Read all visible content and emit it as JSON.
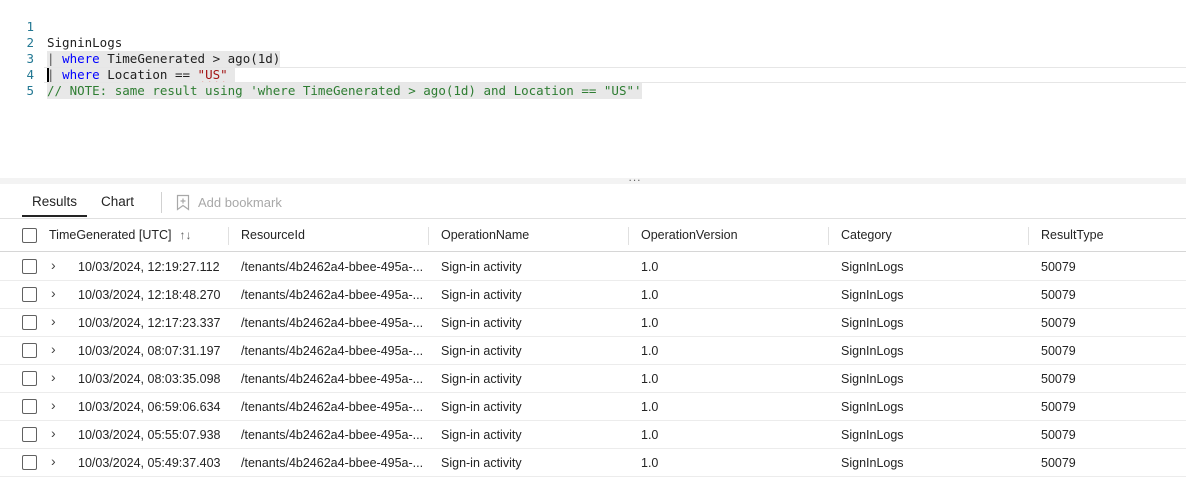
{
  "editor": {
    "line_numbers": [
      "1",
      "2",
      "3",
      "4",
      "5"
    ],
    "line1": "SigninLogs",
    "line2": {
      "pipe": "| ",
      "keyword": "where",
      "rest": " TimeGenerated > ago(1d)"
    },
    "line3": {
      "pipe": "| ",
      "keyword": "where",
      "rest": " Location == ",
      "string": "\"US\""
    },
    "line4_comment": "// NOTE: same result using 'where TimeGenerated > ago(1d) and Location == \"US\"'"
  },
  "splitter": {
    "dots": "..."
  },
  "tabs": {
    "results": "Results",
    "chart": "Chart",
    "add_bookmark": "Add bookmark"
  },
  "grid": {
    "columns": {
      "time": "TimeGenerated [UTC]",
      "resource": "ResourceId",
      "operation": "OperationName",
      "version": "OperationVersion",
      "category": "Category",
      "result_type": "ResultType"
    },
    "sort_icon": "↑↓",
    "expander_icon": "›",
    "rows": [
      {
        "time": "10/03/2024, 12:19:27.112",
        "resource": "/tenants/4b2462a4-bbee-495a-...",
        "operation": "Sign-in activity",
        "version": "1.0",
        "category": "SignInLogs",
        "result_type": "50079"
      },
      {
        "time": "10/03/2024, 12:18:48.270",
        "resource": "/tenants/4b2462a4-bbee-495a-...",
        "operation": "Sign-in activity",
        "version": "1.0",
        "category": "SignInLogs",
        "result_type": "50079"
      },
      {
        "time": "10/03/2024, 12:17:23.337",
        "resource": "/tenants/4b2462a4-bbee-495a-...",
        "operation": "Sign-in activity",
        "version": "1.0",
        "category": "SignInLogs",
        "result_type": "50079"
      },
      {
        "time": "10/03/2024, 08:07:31.197",
        "resource": "/tenants/4b2462a4-bbee-495a-...",
        "operation": "Sign-in activity",
        "version": "1.0",
        "category": "SignInLogs",
        "result_type": "50079"
      },
      {
        "time": "10/03/2024, 08:03:35.098",
        "resource": "/tenants/4b2462a4-bbee-495a-...",
        "operation": "Sign-in activity",
        "version": "1.0",
        "category": "SignInLogs",
        "result_type": "50079"
      },
      {
        "time": "10/03/2024, 06:59:06.634",
        "resource": "/tenants/4b2462a4-bbee-495a-...",
        "operation": "Sign-in activity",
        "version": "1.0",
        "category": "SignInLogs",
        "result_type": "50079"
      },
      {
        "time": "10/03/2024, 05:55:07.938",
        "resource": "/tenants/4b2462a4-bbee-495a-...",
        "operation": "Sign-in activity",
        "version": "1.0",
        "category": "SignInLogs",
        "result_type": "50079"
      },
      {
        "time": "10/03/2024, 05:49:37.403",
        "resource": "/tenants/4b2462a4-bbee-495a-...",
        "operation": "Sign-in activity",
        "version": "1.0",
        "category": "SignInLogs",
        "result_type": "50079"
      }
    ]
  }
}
